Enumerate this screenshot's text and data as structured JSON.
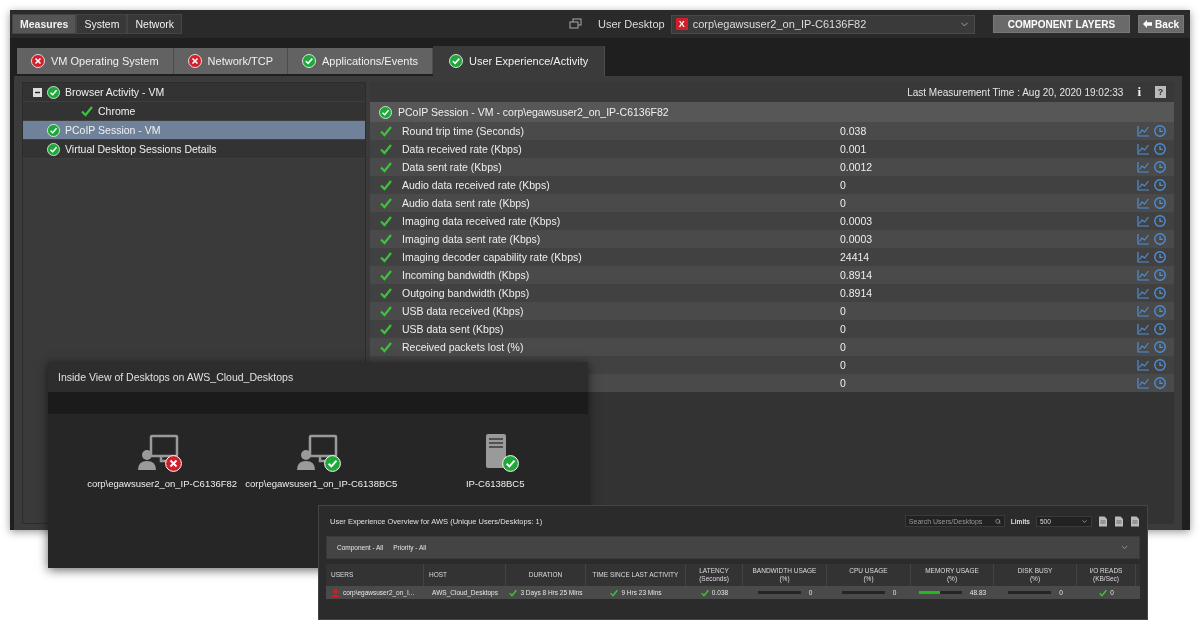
{
  "top_tabs": [
    {
      "label": "Measures",
      "selected": true
    },
    {
      "label": "System",
      "selected": false
    },
    {
      "label": "Network",
      "selected": false
    }
  ],
  "user_desktop": {
    "label": "User Desktop",
    "value": "corp\\egawsuser2_on_IP-C6136F82",
    "error": true,
    "status_label": "X"
  },
  "buttons": {
    "component_layers": "COMPONENT LAYERS",
    "back": "Back"
  },
  "layer_tabs": [
    {
      "label": "VM Operating System",
      "error": true,
      "selected": false
    },
    {
      "label": "Network/TCP",
      "error": true,
      "selected": false
    },
    {
      "label": "Applications/Events",
      "error": false,
      "selected": false
    },
    {
      "label": "User Experience/Activity",
      "error": false,
      "selected": true
    }
  ],
  "tree": [
    {
      "label": "Browser Activity - VM",
      "error": false,
      "selected": false,
      "expanded": true,
      "children": [
        {
          "label": "Chrome",
          "error": false,
          "selected": false
        }
      ]
    },
    {
      "label": "PCoIP Session - VM",
      "error": false,
      "selected": true
    },
    {
      "label": "Virtual Desktop Sessions Details",
      "error": false,
      "selected": false
    }
  ],
  "measures": {
    "last_measurement": "Last Measurement Time : Aug 20, 2020 19:02:33",
    "info": "i",
    "help": "?",
    "section": {
      "title": "PCoIP Session - VM - corp\\egawsuser2_on_IP-C6136F82",
      "error": false
    },
    "rows": [
      {
        "label": "Round trip time (Seconds)",
        "value": "0.038",
        "error": false
      },
      {
        "label": "Data received rate (Kbps)",
        "value": "0.001",
        "error": false
      },
      {
        "label": "Data sent rate (Kbps)",
        "value": "0.0012",
        "error": false
      },
      {
        "label": "Audio data received rate (Kbps)",
        "value": "0",
        "error": false
      },
      {
        "label": "Audio data sent rate (Kbps)",
        "value": "0",
        "error": false
      },
      {
        "label": "Imaging data received rate (Kbps)",
        "value": "0.0003",
        "error": false
      },
      {
        "label": "Imaging data sent rate (Kbps)",
        "value": "0.0003",
        "error": false
      },
      {
        "label": "Imaging decoder capability rate (Kbps)",
        "value": "24414",
        "error": false
      },
      {
        "label": "Incoming bandwidth (Kbps)",
        "value": "0.8914",
        "error": false
      },
      {
        "label": "Outgoing bandwidth (Kbps)",
        "value": "0.8914",
        "error": false
      },
      {
        "label": "USB data received (Kbps)",
        "value": "0",
        "error": false
      },
      {
        "label": "USB data sent (Kbps)",
        "value": "0",
        "error": false
      },
      {
        "label": "Received packets lost (%)",
        "value": "0",
        "error": false
      },
      {
        "value": "0"
      },
      {
        "value": "0"
      }
    ]
  },
  "desktops_window": {
    "title": "Inside View of Desktops on AWS_Cloud_Desktops",
    "items": [
      {
        "kind": "desktop",
        "label": "corp\\egawsuser2_on_IP-C6136F82",
        "error": true
      },
      {
        "kind": "desktop",
        "label": "corp\\egawsuser1_on_IP-C6138BC5",
        "error": false
      },
      {
        "kind": "server",
        "label": "IP-C6138BC5",
        "error": false
      }
    ]
  },
  "overview": {
    "title": "User Experience Overview for AWS (Unique Users/Desktops: 1)",
    "search": {
      "placeholder": "Search Users/Desktops"
    },
    "limits": {
      "label": "Limits",
      "value": "500"
    },
    "filters": [
      "Component - All",
      "Priority - All"
    ],
    "columns": [
      {
        "label": "USERS"
      },
      {
        "label": "HOST"
      },
      {
        "label": "DURATION"
      },
      {
        "label": "TIME SINCE LAST ACTIVITY"
      },
      {
        "label": "LATENCY",
        "unit": "(Seconds)"
      },
      {
        "label": "BANDWIDTH USAGE",
        "unit": "(%)"
      },
      {
        "label": "CPU USAGE",
        "unit": "(%)"
      },
      {
        "label": "MEMORY USAGE",
        "unit": "(%)"
      },
      {
        "label": "DISK BUSY",
        "unit": "(%)"
      },
      {
        "label": "I/O READS",
        "unit": "(KB/Sec)"
      }
    ],
    "rows": [
      {
        "cells": [
          {
            "kind": "user",
            "text": "corp\\egawsuser2_on_I...",
            "error": true
          },
          {
            "kind": "text",
            "text": "AWS_Cloud_Desktops"
          },
          {
            "kind": "status",
            "text": "3 Days 8 Hrs 25 Mins",
            "error": false
          },
          {
            "kind": "status",
            "text": "9 Hrs 23 Mins",
            "error": false
          },
          {
            "kind": "status",
            "text": "0.038",
            "error": false
          },
          {
            "kind": "bar",
            "text": "0",
            "level": 0
          },
          {
            "kind": "bar",
            "text": "0",
            "level": 0
          },
          {
            "kind": "bar",
            "text": "48.83",
            "level": 0.49
          },
          {
            "kind": "bar",
            "text": "0",
            "level": 0
          },
          {
            "kind": "status",
            "text": "0",
            "error": false
          }
        ]
      }
    ]
  }
}
